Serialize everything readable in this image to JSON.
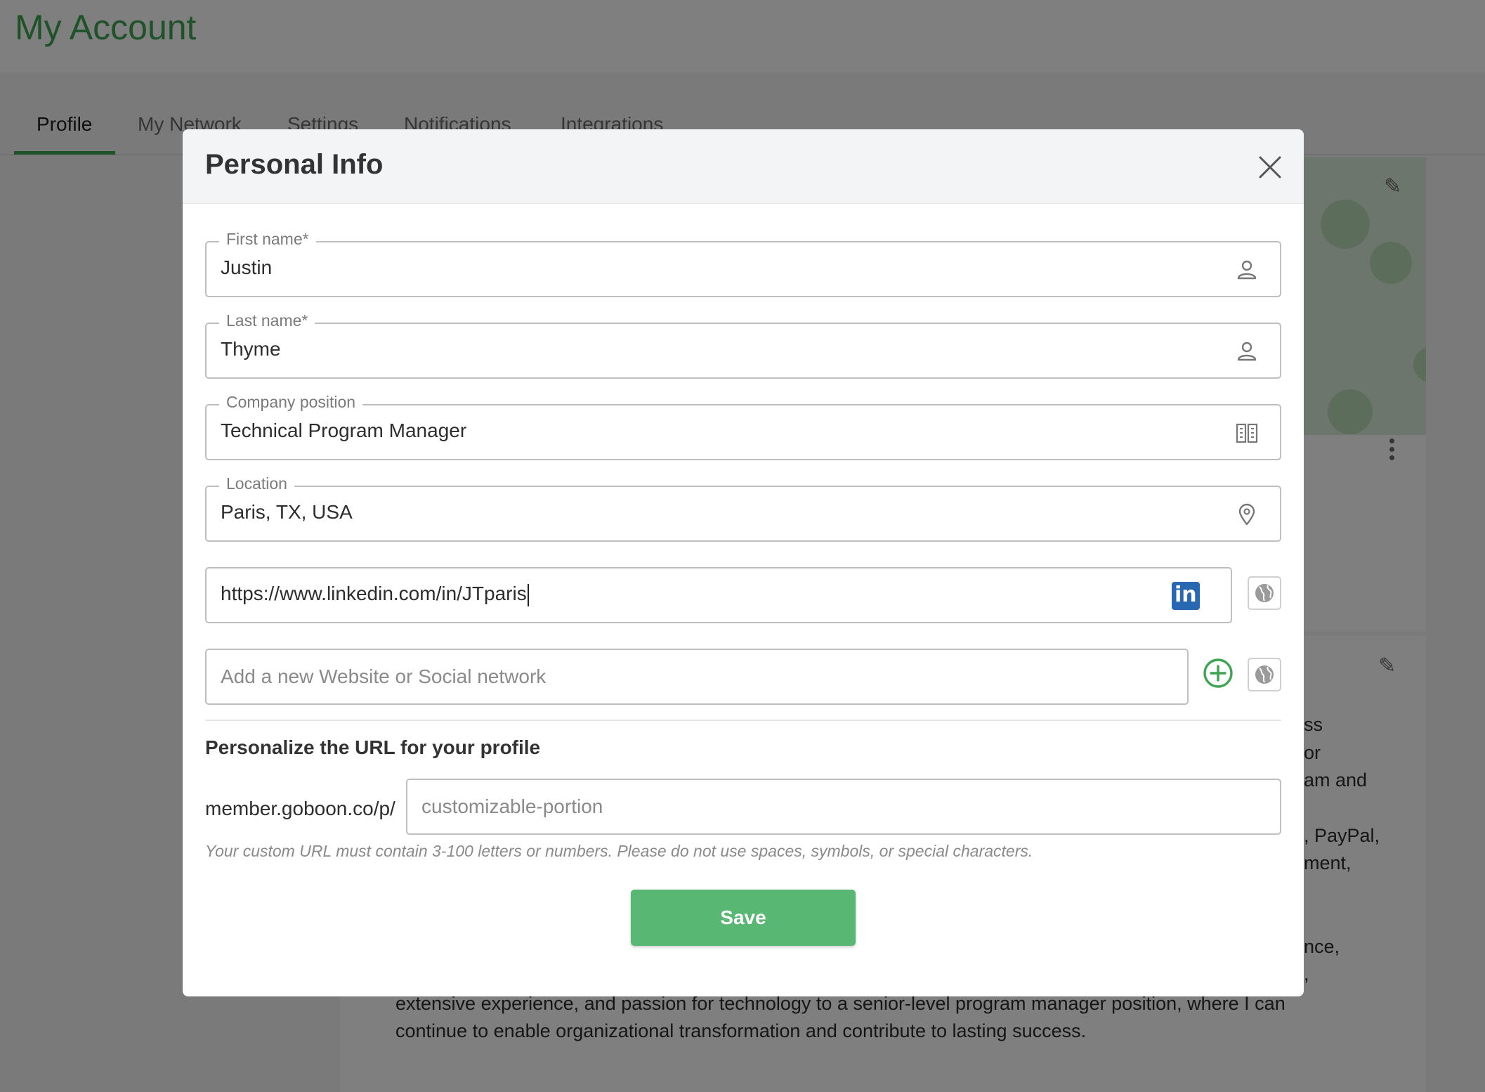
{
  "page": {
    "title": "My Account",
    "tabs": [
      "Profile",
      "My Network",
      "Settings",
      "Notifications",
      "Integrations"
    ],
    "active_tab": "Profile"
  },
  "background_about_text": {
    "right_fragments": [
      "ss",
      "or",
      "am and",
      ", PayPal,",
      "ment,",
      "nce,",
      ","
    ],
    "bottom_lines": [
      "extensive experience, and passion for technology to a senior-level program manager position, where I can",
      "continue to enable organizational transformation and contribute to lasting success."
    ]
  },
  "modal": {
    "title": "Personal Info",
    "close_icon": "close-icon",
    "fields": {
      "first_name": {
        "label": "First name*",
        "value": "Justin",
        "icon": "person-icon"
      },
      "last_name": {
        "label": "Last name*",
        "value": "Thyme",
        "icon": "person-icon"
      },
      "company_position": {
        "label": "Company position",
        "value": "Technical Program Manager",
        "icon": "building-icon"
      },
      "location": {
        "label": "Location",
        "value": "Paris, TX, USA",
        "icon": "location-pin-icon"
      }
    },
    "social_link": {
      "value": "https://www.linkedin.com/in/JTparis",
      "badge": "in",
      "icon": "linkedin-icon"
    },
    "add_website": {
      "placeholder": "Add a new Website or Social network",
      "add_icon": "plus-circle-icon",
      "visibility_icon": "globe-icon"
    },
    "personalize": {
      "heading": "Personalize the URL for your profile",
      "prefix": "member.goboon.co/p/",
      "placeholder": "customizable-portion",
      "hint": "Your custom URL must contain 3-100 letters or numbers. Please do not use spaces, symbols, or special characters."
    },
    "save_label": "Save",
    "accent_color": "#58b873"
  }
}
